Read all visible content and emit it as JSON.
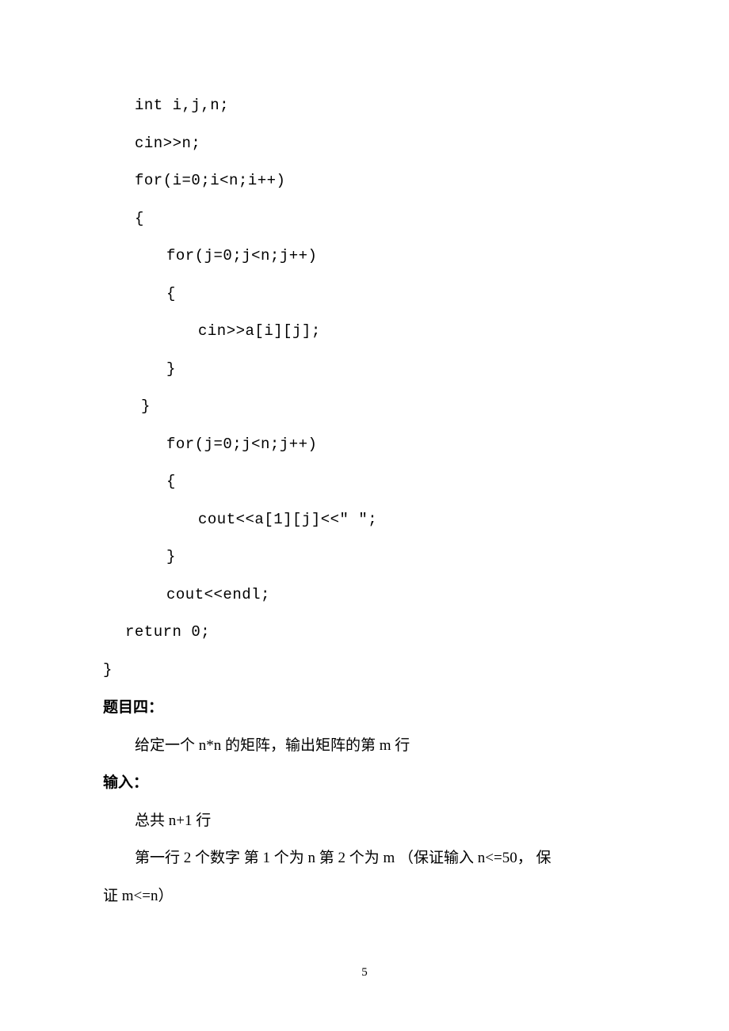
{
  "code": {
    "l1": "int i,j,n;",
    "l2": "cin>>n;",
    "l3": "for(i=0;i<n;i++)",
    "l4": "{",
    "l5": "for(j=0;j<n;j++)",
    "l6": "{",
    "l7": "cin>>a[i][j];",
    "l8": "}",
    "l9": "}",
    "l10": "for(j=0;j<n;j++)",
    "l11": "{",
    "l12": "cout<<a[1][j]<<\" \";",
    "l13": "}",
    "l14": "cout<<endl;",
    "l15": "return 0;",
    "l16": "}"
  },
  "section4_title": "题目四：",
  "section4_desc": "给定一个 n*n 的矩阵，输出矩阵的第 m 行",
  "input_title": "输入：",
  "input_line1": "总共 n+1 行",
  "input_line2": "第一行  2 个数字  第 1 个为 n  第 2 个为 m （保证输入 n<=50，  保",
  "input_line2_cont": "证 m<=n）",
  "page_num": "5"
}
